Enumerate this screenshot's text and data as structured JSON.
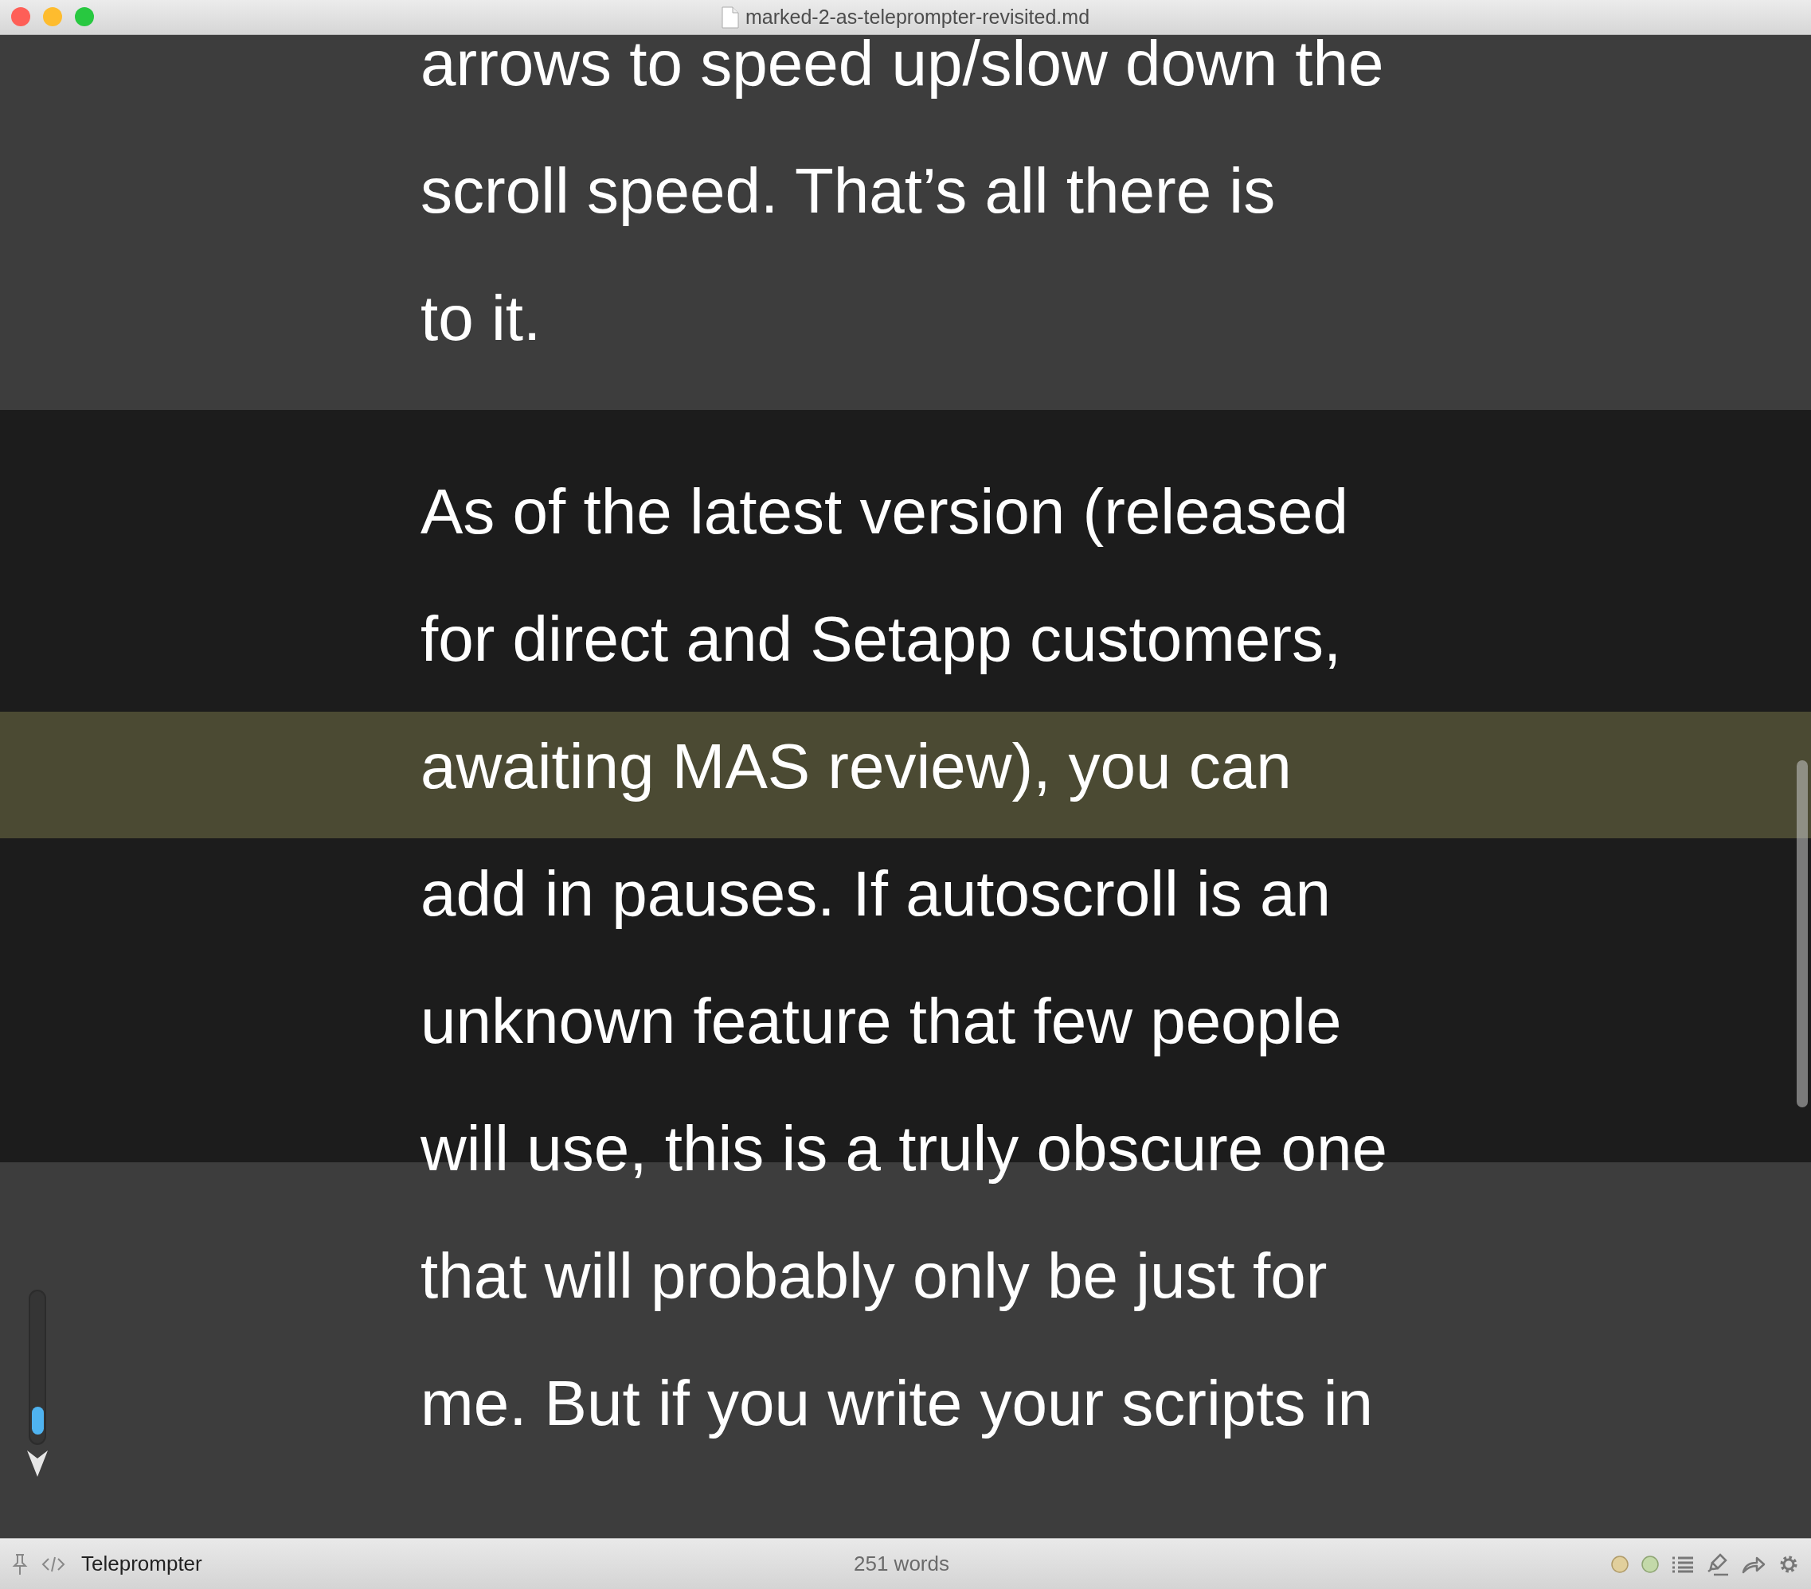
{
  "window": {
    "title": "marked-2-as-teleprompter-revisited.md"
  },
  "document": {
    "paragraphs": [
      {
        "lines": [
          "arrows to speed up/slow down the",
          "scroll speed. That’s all there is",
          "to it."
        ]
      },
      {
        "lines": [
          "As of the latest version (released",
          "for direct and Setapp customers,",
          "awaiting MAS review), you can",
          "add in pauses. If autoscroll is an",
          "unknown feature that few people",
          "will use, this is a truly obscure one",
          "that will probably only be just for",
          "me. But if you write your scripts in"
        ]
      }
    ]
  },
  "speed_slider": {
    "level": 0.06
  },
  "status_bar": {
    "mode": "Teleprompter",
    "word_count": "251 words"
  }
}
